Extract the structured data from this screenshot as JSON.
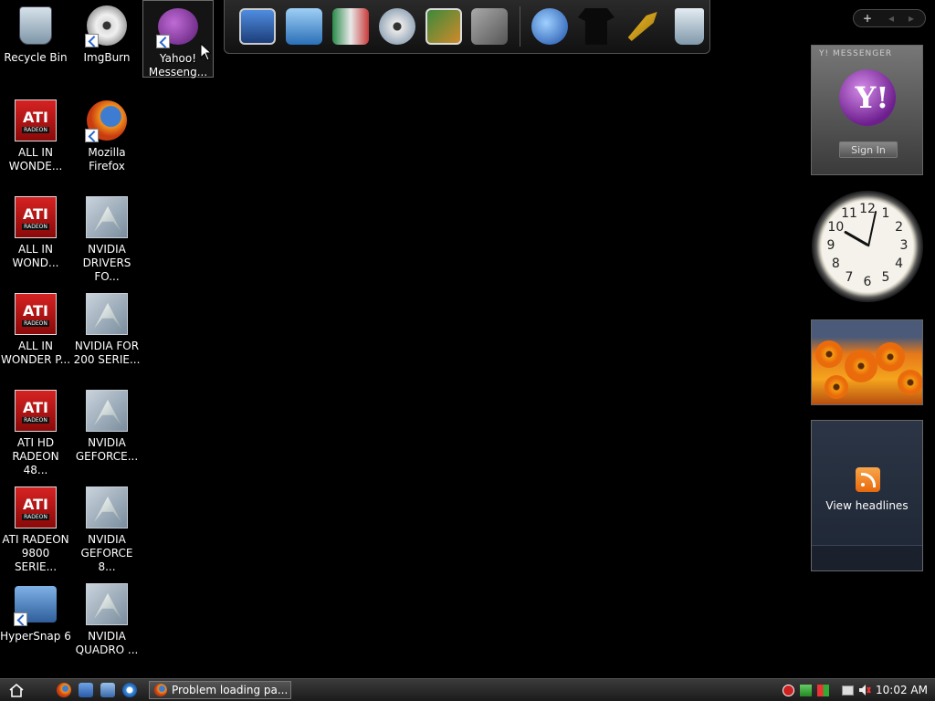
{
  "desktop": {
    "icons": [
      {
        "label": "Recycle Bin"
      },
      {
        "label": "ImgBurn"
      },
      {
        "label": "Yahoo!\nMesseng..."
      },
      {
        "label": "ALL IN\nWONDE..."
      },
      {
        "label": "Mozilla\nFirefox"
      },
      {
        "label": "ALL IN\nWOND..."
      },
      {
        "label": "NVIDIA\nDRIVERS FO..."
      },
      {
        "label": "ALL IN\nWONDER P..."
      },
      {
        "label": "NVIDIA FOR\n200 SERIE..."
      },
      {
        "label": "ATI HD\nRADEON 48..."
      },
      {
        "label": "NVIDIA\nGEFORCE..."
      },
      {
        "label": "ATI RADEON\n9800 SERIE..."
      },
      {
        "label": "NVIDIA\nGEFORCE 8..."
      },
      {
        "label": "HyperSnap 6"
      },
      {
        "label": "NVIDIA\nQUADRO ..."
      }
    ],
    "ati_brand": "ATI",
    "ati_sub": "RADEON"
  },
  "sidebar": {
    "add_button": "+",
    "prev_button": "◂",
    "next_button": "▸"
  },
  "messenger_gadget": {
    "brand": "Y! MESSENGER",
    "logo_text": "Y!",
    "sign_in_label": "Sign In"
  },
  "clock_gadget": {
    "numbers": [
      "12",
      "1",
      "2",
      "3",
      "4",
      "5",
      "6",
      "7",
      "8",
      "9",
      "10",
      "11"
    ]
  },
  "feeds_gadget": {
    "label": "View headlines"
  },
  "taskbar": {
    "active_task": "Problem loading pa...",
    "time": "10:02 AM"
  },
  "colors": {
    "ati_red": "#d62222",
    "feed_orange": "#f0901c",
    "yahoo_purple": "#7a2a9a"
  }
}
